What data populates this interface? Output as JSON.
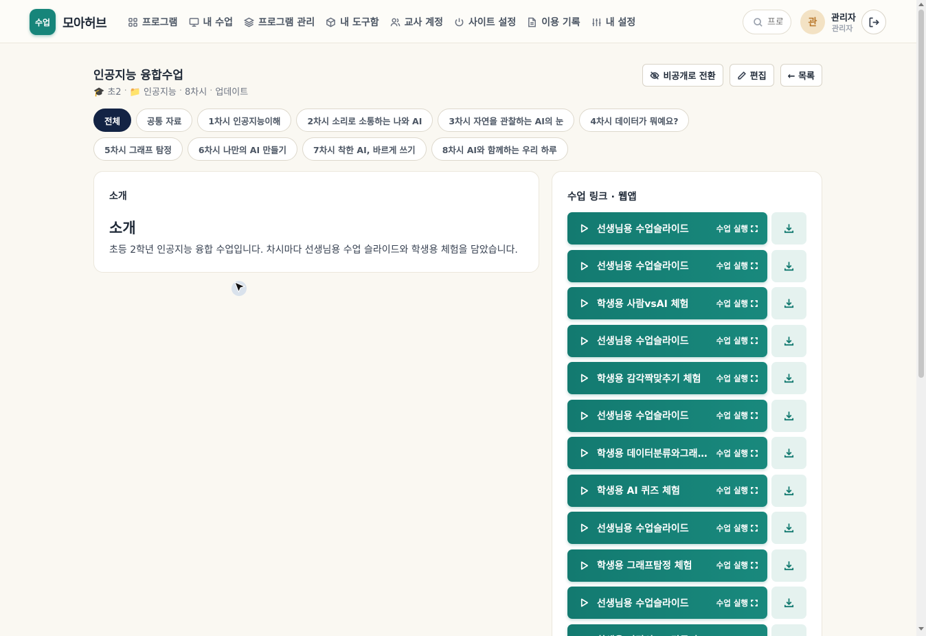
{
  "header": {
    "logo_badge": "수업",
    "logo_text": "모아허브",
    "nav": [
      {
        "label": "프로그램",
        "icon": "grid-icon"
      },
      {
        "label": "내 수업",
        "icon": "monitor-icon"
      },
      {
        "label": "프로그램 관리",
        "icon": "layers-icon"
      },
      {
        "label": "내 도구함",
        "icon": "box-icon"
      },
      {
        "label": "교사 계정",
        "icon": "users-icon"
      },
      {
        "label": "사이트 설정",
        "icon": "power-icon"
      },
      {
        "label": "이용 기록",
        "icon": "file-text-icon"
      },
      {
        "label": "내 설정",
        "icon": "sliders-icon"
      }
    ],
    "search_placeholder": "프로그램",
    "avatar_initial": "관",
    "user_name": "관리자",
    "user_role": "관리자"
  },
  "page": {
    "title": "인공지능 융합수업",
    "meta": {
      "grade": "🎓 초2",
      "category": "📁 인공지능",
      "sessions": "8차시",
      "status": "업데이트"
    },
    "actions": {
      "private": "비공개로 전환",
      "edit": "편집",
      "list": "← 목록"
    }
  },
  "tabs": [
    {
      "label": "전체",
      "active": true
    },
    {
      "label": "공통 자료",
      "active": false
    },
    {
      "label": "1차시 인공지능이해",
      "active": false
    },
    {
      "label": "2차시 소리로 소통하는 나와 AI",
      "active": false
    },
    {
      "label": "3차시 자연을 관찰하는 AI의 눈",
      "active": false
    },
    {
      "label": "4차시 데이터가 뭐예요?",
      "active": false
    },
    {
      "label": "5차시 그래프 탐정",
      "active": false
    },
    {
      "label": "6차시 나만의 AI 만들기",
      "active": false
    },
    {
      "label": "7차시 착한 AI, 바르게 쓰기",
      "active": false
    },
    {
      "label": "8차시 AI와 함께하는 우리 하루",
      "active": false
    }
  ],
  "intro": {
    "label": "소개",
    "heading": "소개",
    "body": "초등 2학년 인공지능 융합 수업입니다. 차시마다 선생님용 수업 슬라이드와 학생용 체험을 담았습니다."
  },
  "links": {
    "title": "수업 링크 · 웹앱",
    "run_label": "수업 실행",
    "items": [
      "선생님용 수업슬라이드",
      "선생님용 수업슬라이드",
      "학생용 사람vsAI 체험",
      "선생님용 수업슬라이드",
      "학생용 감각짝맞추기 체험",
      "선생님용 수업슬라이드",
      "학생용 데이터분류와그래프만들기 체험",
      "학생용 AI 퀴즈 체험",
      "선생님용 수업슬라이드",
      "학생용 그래프탐정 체험",
      "선생님용 수업슬라이드",
      "학생용 나만의 AI 만들기 체험"
    ]
  },
  "colors": {
    "accent": "#17857a",
    "tab_active": "#132344",
    "background": "#faf8f2"
  }
}
